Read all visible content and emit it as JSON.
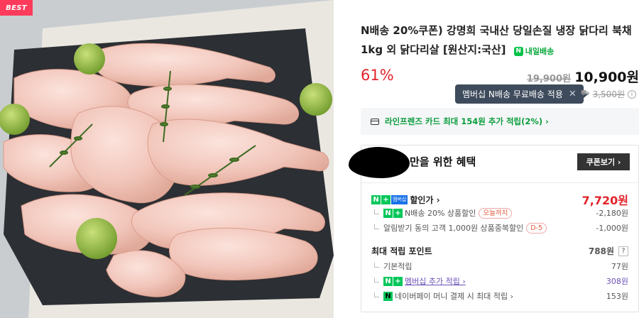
{
  "badge": {
    "best": "BEST"
  },
  "product": {
    "title": "N배송 20%쿠폰) 강명희 국내산 당일손질 냉장 닭다리 북채 1kg 외 닭다리살 [원산지:국산]",
    "delivery_badge": "내일배송",
    "discount_rate": "61%",
    "original_price": "19,900원",
    "sale_price": "10,900원"
  },
  "shipping": {
    "tooltip": "멤버십 N배송 무료배송 적용",
    "fee": "3,500원"
  },
  "card_promo": {
    "text": "라인프렌즈 카드 최대 154원 추가 적립(2%) ›"
  },
  "benefits": {
    "title": "만을 위한 혜택",
    "coupon_button": "쿠폰보기 ›",
    "discount_price": {
      "label": "할인가 ›",
      "amount": "7,720원",
      "member_tag": "멤버십",
      "items": [
        {
          "label": "N배송 20% 상품할인",
          "tag": "오늘까지",
          "amount": "-2,180원"
        },
        {
          "label": "알림받기 동의 고객 1,000원 상품중복할인",
          "tag": "D-5",
          "amount": "-1,000원"
        }
      ]
    },
    "points": {
      "label": "최대 적립 포인트",
      "amount": "788원",
      "help": "?",
      "items": [
        {
          "label": "기본적립",
          "amount": "77원"
        },
        {
          "label": "멤버십 추가 적립 ›",
          "amount": "308원"
        },
        {
          "label": "네이버페이 머니 결제 시 최대 적립 ›",
          "amount": "153원"
        }
      ]
    }
  },
  "colors": {
    "discount_red": "#e2232a",
    "naver_green": "#03c75a",
    "purple_point": "#6b4fb8",
    "tooltip_bg": "#3e4b5c"
  }
}
